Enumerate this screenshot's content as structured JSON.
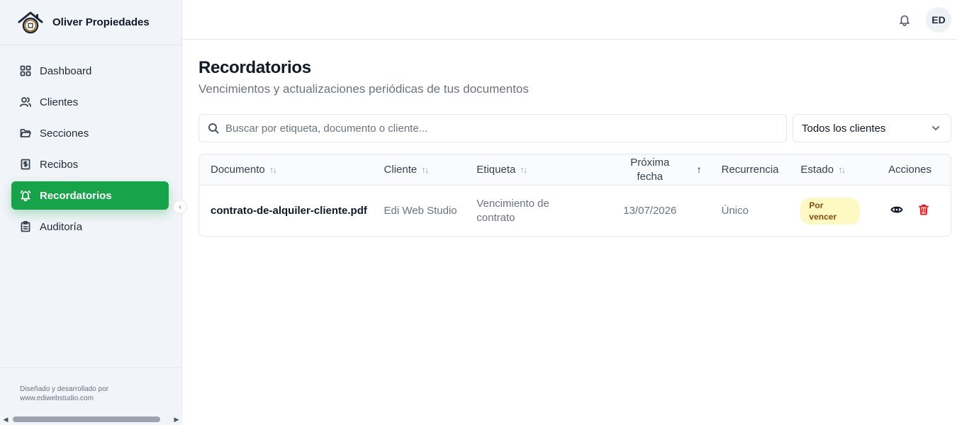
{
  "brand": {
    "name": "Oliver Propiedades",
    "logo_icon": "house-logo-icon"
  },
  "sidebar": {
    "items": [
      {
        "label": "Dashboard",
        "icon": "grid-icon"
      },
      {
        "label": "Clientes",
        "icon": "users-icon"
      },
      {
        "label": "Secciones",
        "icon": "folder-icon"
      },
      {
        "label": "Recibos",
        "icon": "receipt-icon"
      },
      {
        "label": "Recordatorios",
        "icon": "bell-icon",
        "active": true
      },
      {
        "label": "Auditoría",
        "icon": "clipboard-icon"
      }
    ],
    "footer_line1": "Diseñado y desarrollado por",
    "footer_line2": "www.ediwebstudio.com"
  },
  "topbar": {
    "avatar_initials": "ED",
    "notification_icon": "bell-icon"
  },
  "page": {
    "title": "Recordatorios",
    "subtitle": "Vencimientos y actualizaciones periódicas de tus documentos"
  },
  "filters": {
    "search_placeholder": "Buscar por etiqueta, documento o cliente...",
    "client_select": "Todos los clientes"
  },
  "table": {
    "columns": {
      "documento": "Documento",
      "cliente": "Cliente",
      "etiqueta": "Etiqueta",
      "proxima_fecha_1": "Próxima",
      "proxima_fecha_2": "fecha",
      "recurrencia": "Recurrencia",
      "estado": "Estado",
      "acciones": "Acciones"
    },
    "rows": [
      {
        "documento": "contrato-de-alquiler-cliente.pdf",
        "cliente": "Edi Web Studio",
        "etiqueta": "Vencimiento de contrato",
        "proxima_fecha": "13/07/2026",
        "recurrencia": "Único",
        "estado": "Por vencer"
      }
    ]
  },
  "colors": {
    "accent": "#16a34a",
    "badge_bg": "#fef9c3",
    "badge_text": "#854d0e",
    "danger": "#dc2626"
  }
}
